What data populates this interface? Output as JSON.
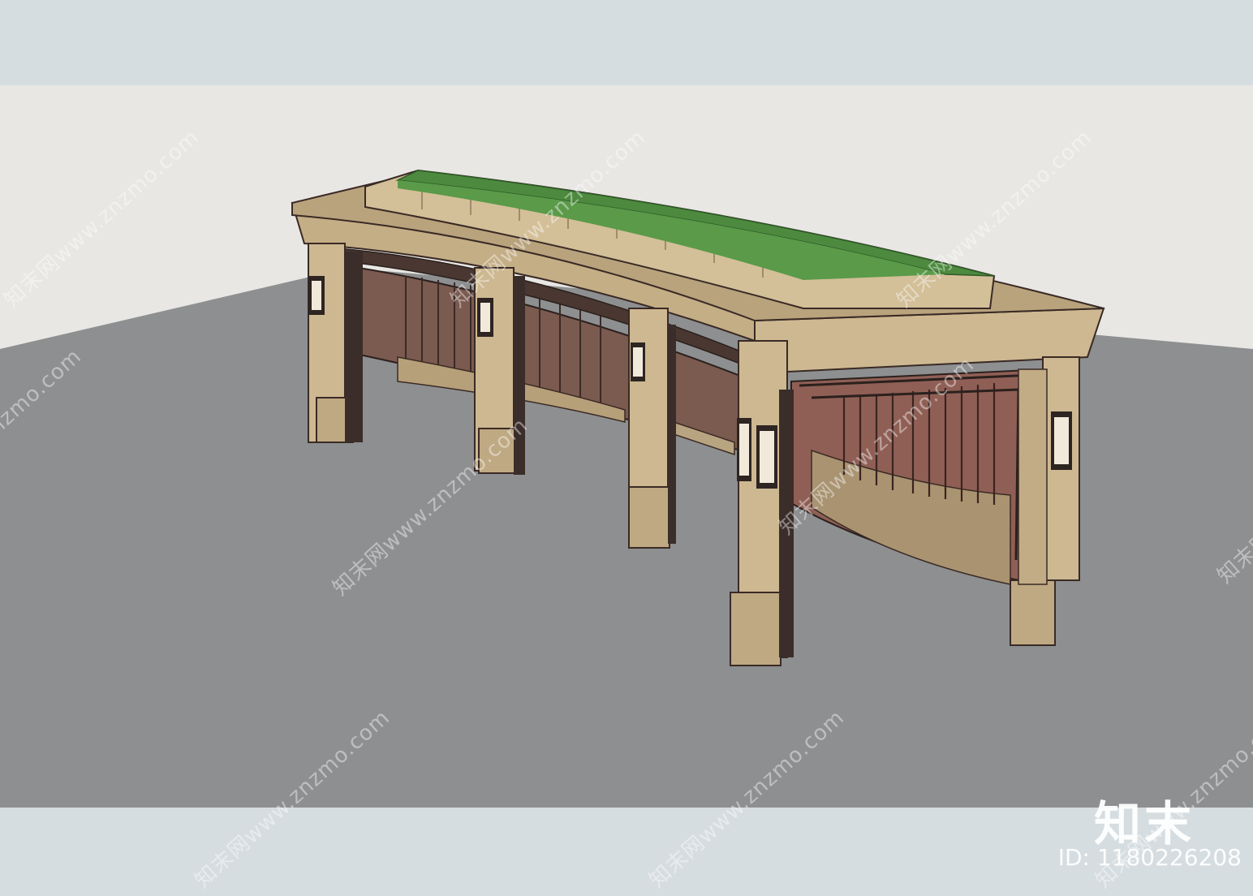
{
  "image": {
    "kind": "3D model viewport render",
    "subject": "curved pergola gateway with green roof planter"
  },
  "scene": {
    "sky_color": "#d6dde0",
    "ground_color": "#8d8f90",
    "backdrop_color": "#e8e7e4",
    "stone_color": "#c9b58f",
    "grass_color": "#4d8a3f",
    "timber_color": "#8a5347",
    "iron_color": "#3b2d2a"
  },
  "watermark": {
    "text": "知末网www.znzmo.com",
    "brand": "知末",
    "id_text": "ID: 1180226208"
  }
}
